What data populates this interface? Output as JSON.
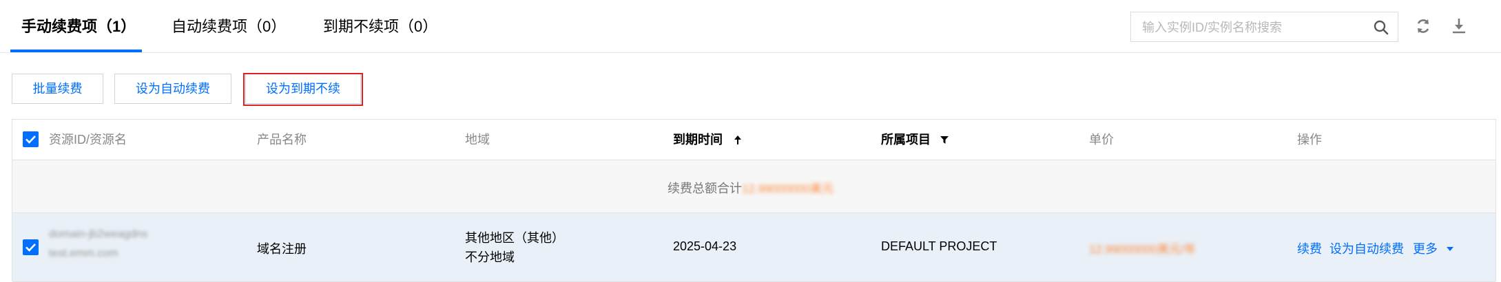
{
  "tabs": [
    {
      "label": "手动续费项（1）"
    },
    {
      "label": "自动续费项（0）"
    },
    {
      "label": "到期不续项（0）"
    }
  ],
  "search": {
    "placeholder": "输入实例ID/实例名称搜索"
  },
  "toolbar": {
    "refresh_icon": "refresh-icon",
    "download_icon": "download-icon"
  },
  "actions": {
    "batch_renew": "批量续费",
    "set_auto_renew": "设为自动续费",
    "set_no_renew": "设为到期不续"
  },
  "table": {
    "headers": {
      "resource": "资源ID/资源名",
      "product": "产品名称",
      "region": "地域",
      "expire": "到期时间",
      "project": "所属项目",
      "price": "单价",
      "ops": "操作"
    },
    "sum_label": "续费总额合计",
    "sum_value": "12.99000000美元",
    "rows": [
      {
        "resource_id": "domain-jb2weagdns",
        "resource_name": "test.emm.com",
        "product": "域名注册",
        "region_line1": "其他地区（其他）",
        "region_line2": "不分地域",
        "expire": "2025-04-23",
        "project": "DEFAULT PROJECT",
        "price": "12.99000000美元/年",
        "op_renew": "续费",
        "op_auto": "设为自动续费",
        "op_more": "更多"
      }
    ]
  },
  "colors": {
    "accent": "#006eff",
    "highlight": "#e02020",
    "masked": "#ff8a3d"
  }
}
